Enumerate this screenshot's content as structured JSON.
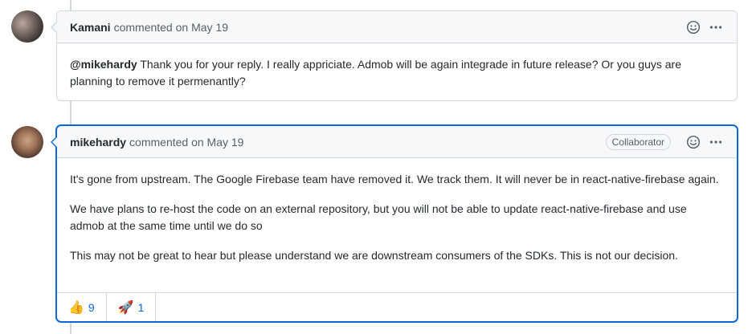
{
  "comments": [
    {
      "author": "Kamani",
      "meta": "commented on May 19",
      "mention": "@mikehardy",
      "body": [
        "Thank you for your reply. I really appriciate. Admob will be again integrade in future release? Or you guys are planning to remove it permenantly?"
      ]
    },
    {
      "author": "mikehardy",
      "meta": "commented on May 19",
      "badge": "Collaborator",
      "body": [
        "It's gone from upstream. The Google Firebase team have removed it. We track them. It will never be in react-native-firebase again.",
        "We have plans to re-host the code on an external repository, but you will not be able to update react-native-firebase and use admob at the same time until we do so",
        "This may not be great to hear but please understand we are downstream consumers of the SDKs. This is not our decision."
      ],
      "reactions": [
        {
          "emoji": "👍",
          "icon": "thumbs-up",
          "count": "9"
        },
        {
          "emoji": "🚀",
          "icon": "rocket",
          "count": "1"
        }
      ]
    }
  ]
}
